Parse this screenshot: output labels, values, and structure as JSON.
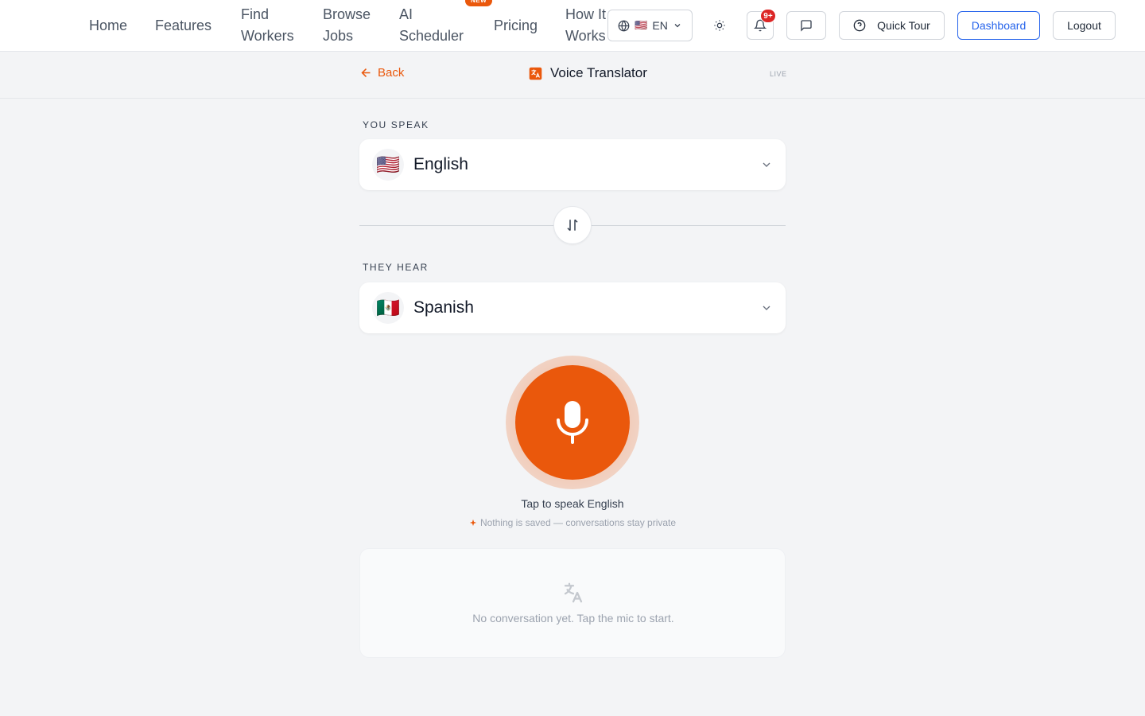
{
  "nav": {
    "links": [
      {
        "line1": "Home",
        "line2": ""
      },
      {
        "line1": "Features",
        "line2": ""
      },
      {
        "line1": "Find",
        "line2": "Workers"
      },
      {
        "line1": "Browse",
        "line2": "Jobs"
      },
      {
        "line1": "AI",
        "line2": "Scheduler"
      },
      {
        "line1": "Pricing",
        "line2": ""
      },
      {
        "line1": "How It",
        "line2": "Works"
      }
    ],
    "new_badge": "NEW",
    "language": {
      "flag": "🇺🇸",
      "code": "EN"
    },
    "notification_count": "9+",
    "quick_tour_label": "Quick Tour",
    "dashboard_label": "Dashboard",
    "logout_label": "Logout"
  },
  "subheader": {
    "back_label": "Back",
    "title": "Voice Translator",
    "live_tag": "LIVE"
  },
  "source": {
    "label": "YOU SPEAK",
    "flag": "🇺🇸",
    "language": "English"
  },
  "target": {
    "label": "THEY HEAR",
    "flag": "🇲🇽",
    "language": "Spanish"
  },
  "mic": {
    "prompt": "Tap to speak English",
    "privacy_note": "Nothing is saved — conversations stay private"
  },
  "conversation": {
    "empty_text": "No conversation yet. Tap the mic to start."
  },
  "colors": {
    "accent": "#ea580c",
    "primary_blue": "#2563eb",
    "notification_red": "#dc2626",
    "background": "#f3f4f6"
  }
}
